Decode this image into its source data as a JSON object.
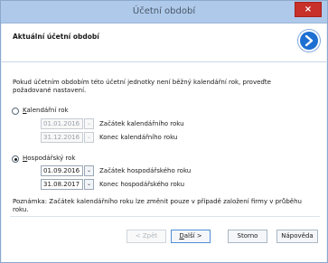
{
  "window": {
    "title": "Účetní období",
    "close_glyph": "×"
  },
  "header": {
    "title": "Aktuální účetní období",
    "icon": "next-arrow-icon",
    "icon_color": "#1d6fd1"
  },
  "intro_text": "Pokud účetním obdobím této účetní jednotky není běžný kalendářní rok, proveďte požadované nastavení.",
  "options": {
    "calendar": {
      "label_mnemonic": "K",
      "label_rest": "alendářní rok",
      "selected": false,
      "start_value": "01.01.2016",
      "end_value": "31.12.2016",
      "start_label": "Začátek kalendářního roku",
      "end_label": "Konec kalendářního roku",
      "enabled": false
    },
    "fiscal": {
      "label_mnemonic": "H",
      "label_rest": "ospodářský rok",
      "selected": true,
      "start_value": "01.09.2016",
      "end_value": "31.08.2017",
      "start_label": "Začátek hospodářského roku",
      "end_label": "Konec hospodářského roku",
      "enabled": true
    }
  },
  "note": "Poznámka: Začátek kalendářního roku lze změnit pouze v případě založení firmy v průběhu roku.",
  "buttons": {
    "back": "< Zpět",
    "next_mnemonic": "D",
    "next_rest": "alší >",
    "cancel": "Storno",
    "help": "Nápověda"
  },
  "calendar_glyph": "⌄"
}
